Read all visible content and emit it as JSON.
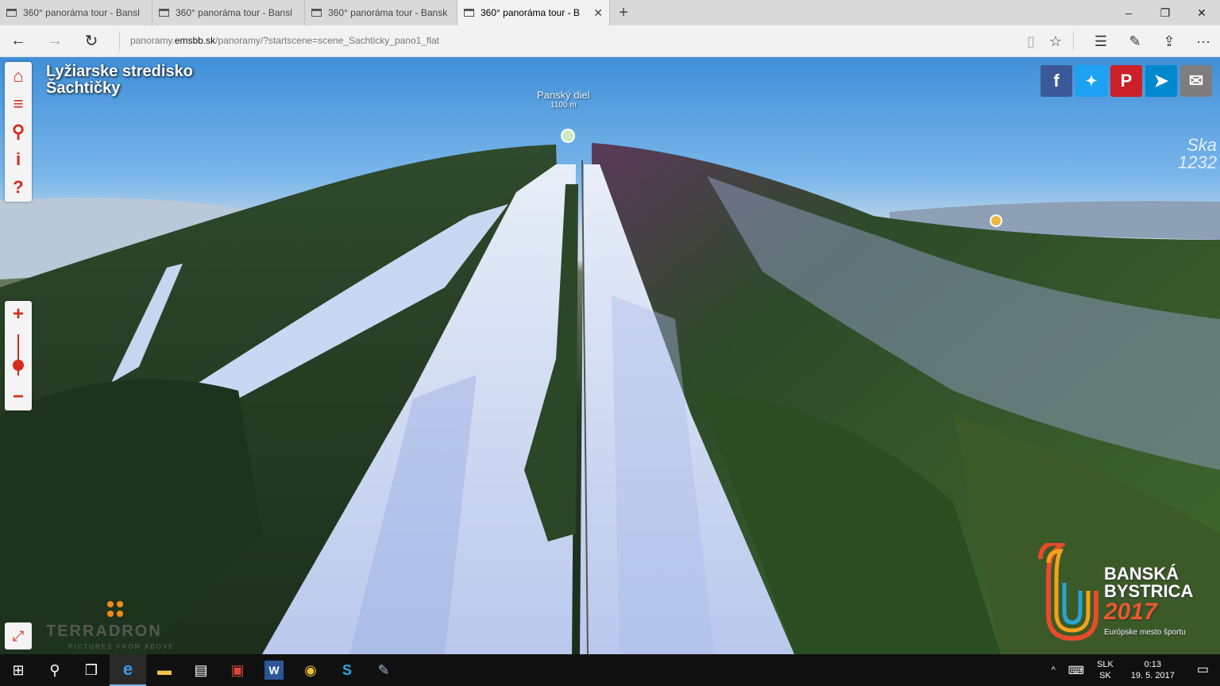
{
  "browser": {
    "tabs": [
      {
        "title": "360° panoráma tour - Bansl",
        "active": false
      },
      {
        "title": "360° panoráma tour - Bansl",
        "active": false
      },
      {
        "title": "360° panoráma tour - Bansk",
        "active": false
      },
      {
        "title": "360° panoráma tour - B",
        "active": true
      }
    ],
    "new_tab_label": "+",
    "url_prefix": "panoramy.",
    "url_domain": "emsbb.sk",
    "url_path": "/panoramy/?startscene=scene_Sachticky_pano1_flat",
    "window_controls": {
      "minimize": "–",
      "restore": "❐",
      "close": "✕"
    },
    "nav": {
      "back": "←",
      "forward": "→",
      "refresh": "↻"
    },
    "toolbar": {
      "reading": "▯",
      "favorite": "☆",
      "hub": "☰",
      "note": "✎",
      "share": "⇪",
      "more": "···"
    }
  },
  "pano": {
    "title_line1": "Lyžiarske stredisko",
    "title_line2": "Šachtičky",
    "hotspot_name": "Panský diel",
    "hotspot_alt": "1100 m",
    "edge_label_1": "Ska",
    "edge_label_2": "1232",
    "sidebar": {
      "home": "⌂",
      "menu": "≡",
      "map": "⚲",
      "info": "i",
      "help": "?"
    },
    "zoom_in": "+",
    "zoom_out": "−",
    "zoom_level": 0.25,
    "fullscreen": "⤢",
    "share": [
      {
        "name": "facebook",
        "glyph": "f",
        "color": "#3b5998"
      },
      {
        "name": "twitter",
        "glyph": "🐦",
        "color": "#1da1f2"
      },
      {
        "name": "pinterest",
        "glyph": "P",
        "color": "#cb2027"
      },
      {
        "name": "telegram",
        "glyph": "➤",
        "color": "#0088cc"
      },
      {
        "name": "email",
        "glyph": "✉",
        "color": "#7d7d7d"
      }
    ],
    "terradron": "TERRADRON",
    "terradron_sub": "PICTURES FROM ABOVE",
    "bb_line1": "BANSKÁ",
    "bb_line2": "BYSTRICA",
    "bb_year": "2017",
    "bb_sub": "Európske mesto športu"
  },
  "taskbar": {
    "start": "⊞",
    "search": "⚲",
    "taskview": "❒",
    "apps": [
      {
        "name": "edge",
        "glyph": "e",
        "active": true
      },
      {
        "name": "explorer",
        "glyph": "📁",
        "active": false
      },
      {
        "name": "store",
        "glyph": "🛍",
        "active": false
      },
      {
        "name": "pdf",
        "glyph": "▣",
        "active": false
      },
      {
        "name": "word",
        "glyph": "W",
        "active": false
      },
      {
        "name": "chrome",
        "glyph": "◉",
        "active": false
      },
      {
        "name": "skype",
        "glyph": "S",
        "active": false
      },
      {
        "name": "paint",
        "glyph": "🎨",
        "active": false
      }
    ],
    "tray_arrow": "^",
    "keyboard": "⌨",
    "lang_1": "SLK",
    "lang_2": "SK",
    "time": "0:13",
    "date": "19. 5. 2017",
    "notifications": "▭"
  }
}
